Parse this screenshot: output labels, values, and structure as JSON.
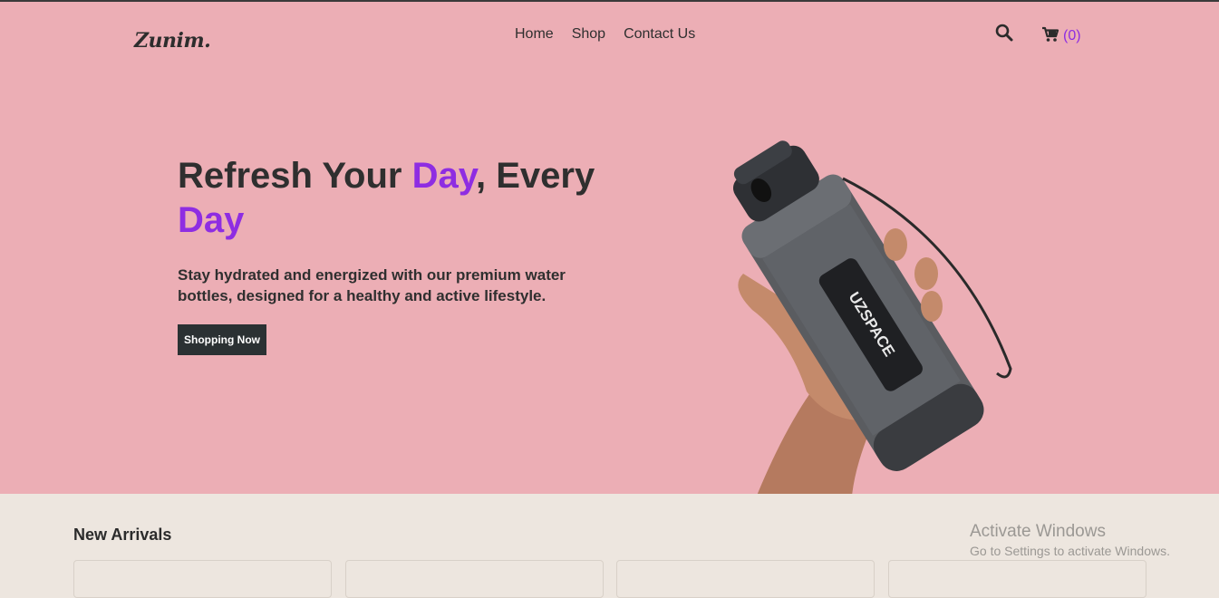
{
  "header": {
    "logo": "Zunim.",
    "nav": [
      "Home",
      "Shop",
      "Contact Us"
    ],
    "cart_count": "(0)",
    "icons": [
      "search-icon",
      "cart-icon"
    ]
  },
  "hero": {
    "headline": {
      "part1": "Refresh Your ",
      "accent1": "Day",
      "part2": ", Every ",
      "accent2": "Day"
    },
    "subtext": "Stay hydrated and energized with our premium water bottles, designed for a healthy and active lifestyle.",
    "cta_label": "Shopping Now",
    "bottle_brand": "UZSPACE"
  },
  "section": {
    "title": "New Arrivals",
    "card_count": 4
  },
  "watermark": {
    "line1": "Activate Windows",
    "line2": "Go to Settings to activate Windows."
  },
  "colors": {
    "hero_bg": "#ecaeb5",
    "accent": "#8e2de2",
    "button_bg": "#2b3133",
    "page_bg": "#ede6df"
  }
}
